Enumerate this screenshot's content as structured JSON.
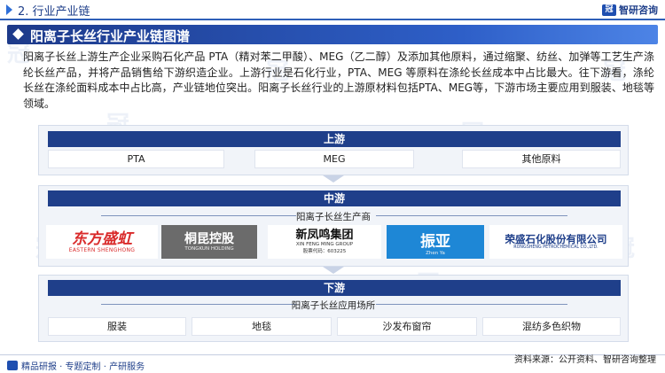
{
  "header": {
    "section_title": "2. 行业产业链",
    "brand_name": "智研咨询"
  },
  "banner": {
    "title": "阳离子长丝行业产业链图谱"
  },
  "intro": "阳离子长丝上游生产企业采购石化产品 PTA（精对苯二甲酸）、MEG（乙二醇）及添加其他原料，通过缩聚、纺丝、加弹等工艺生产涤纶长丝产品，并将产品销售给下游织造企业。上游行业是石化行业，PTA、MEG 等原料在涤纶长丝成本中占比最大。往下游看，涤纶长丝在涤纶面料成本中占比高，产业链地位突出。阳离子长丝行业的上游原材料包括PTA、MEG等，下游市场主要应用到服装、地毯等领域。",
  "upstream": {
    "title": "上游",
    "items": [
      "PTA",
      "MEG",
      "其他原料"
    ]
  },
  "midstream": {
    "title": "中游",
    "subtitle": "阳离子长丝生产商",
    "logos": [
      {
        "name": "东方盛虹",
        "sub": "EASTERN SHENGHONG"
      },
      {
        "name": "桐昆控股",
        "sub": "TONGKUN HOLDING"
      },
      {
        "name": "新凤鸣集团",
        "sub": "XIN FENG MING GROUP",
        "code": "股票代码：603225"
      },
      {
        "name": "振亚",
        "sub": "Zhen Ya"
      },
      {
        "name": "荣盛石化股份有限公司",
        "sub": "RONGSHENG PETROCHEMICAL CO.,LTD."
      }
    ]
  },
  "downstream": {
    "title": "下游",
    "subtitle": "阳离子长丝应用场所",
    "items": [
      "服装",
      "地毯",
      "沙发布窗帘",
      "混纺多色织物"
    ]
  },
  "footer": {
    "tagline": "精品研报 · 专题定制 · 产研服务",
    "source": "资料来源：公开资料、智研咨询整理"
  },
  "colors": {
    "primary": "#1f3f8a",
    "accent": "#2e5fc8",
    "panel": "#f1f4f9"
  }
}
